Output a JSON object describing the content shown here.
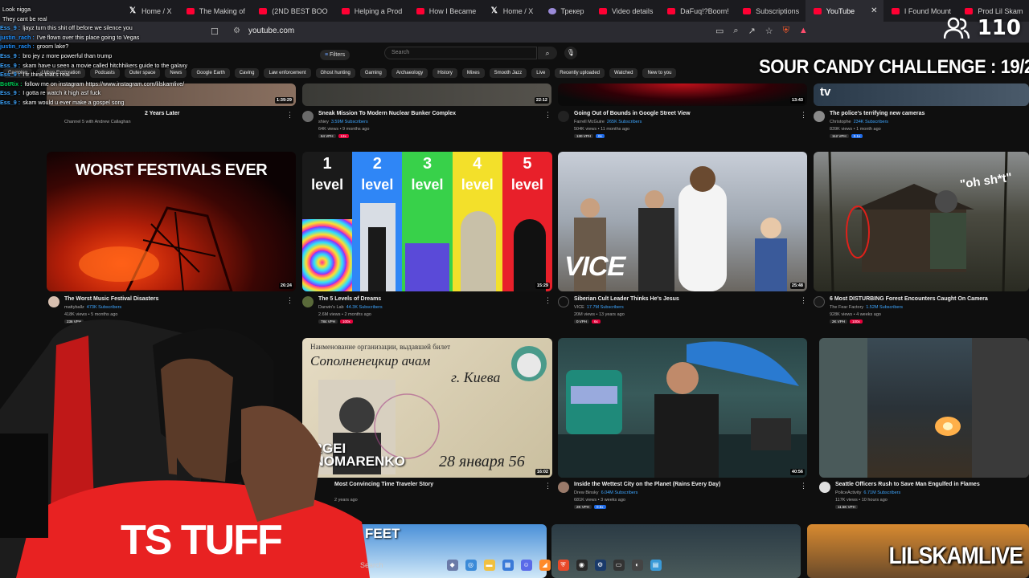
{
  "browser": {
    "tabs": [
      {
        "label": "Home / X",
        "icon": "x-logo-icon"
      },
      {
        "label": "The Making of",
        "icon": "youtube-icon"
      },
      {
        "label": "(2ND BEST BOO",
        "icon": "youtube-icon"
      },
      {
        "label": "Helping a Prod",
        "icon": "youtube-icon"
      },
      {
        "label": "How I Became",
        "icon": "youtube-icon"
      },
      {
        "label": "Home / X",
        "icon": "x-logo-icon"
      },
      {
        "label": "Трекер",
        "icon": "tracker-icon"
      },
      {
        "label": "Video details",
        "icon": "youtube-icon"
      },
      {
        "label": "DaFuq!?Boom!",
        "icon": "youtube-icon"
      },
      {
        "label": "Subscriptions",
        "icon": "youtube-icon"
      },
      {
        "label": "YouTube",
        "icon": "youtube-icon",
        "active": true
      },
      {
        "label": "I Found Mount",
        "icon": "youtube-icon"
      },
      {
        "label": "Prod Lil Skam",
        "icon": "youtube-icon"
      }
    ],
    "close_symbol": "✕",
    "url": "youtube.com"
  },
  "overlay": {
    "viewer_count": "110",
    "challenge": "SOUR CANDY CHALLENGE : 19/250",
    "watermark": "LILSKAMLIVE"
  },
  "chat": [
    {
      "user": "",
      "text": "Look nigga",
      "color": "#9147ff"
    },
    {
      "user": "",
      "text": "They cant be real",
      "color": "#9147ff"
    },
    {
      "user": "Ess_9 :",
      "text": "ljayz turn this shit off before we silence you",
      "color": "#3ea6ff"
    },
    {
      "user": "justin_rach :",
      "text": "I've flown over this place going to Vegas",
      "color": "#1e90ff"
    },
    {
      "user": "justin_rach :",
      "text": "groom lake?",
      "color": "#1e90ff"
    },
    {
      "user": "Ess_9 :",
      "text": "bro jey z more powerful than trump",
      "color": "#3ea6ff"
    },
    {
      "user": "Ess_9 :",
      "text": "skam have u seen a movie called hitchhikers guide to the galaxy",
      "color": "#3ea6ff"
    },
    {
      "user": "Ess_9 :",
      "text": "I fr think that's real",
      "color": "#3ea6ff"
    },
    {
      "user": "BotRix :",
      "text": "follow me on instagram https://www.instagram.com/lilskamlive/",
      "color": "#00c853"
    },
    {
      "user": "Ess_9 :",
      "text": "I gotta re watch it high asf fuck",
      "color": "#3ea6ff"
    },
    {
      "user": "Ess_9 :",
      "text": "skam would u ever make a gospel song",
      "color": "#3ea6ff"
    }
  ],
  "youtube": {
    "filters_label": "Filters",
    "search_placeholder": "Search",
    "chips": [
      "Camping",
      "Urban Exploration",
      "Podcasts",
      "Outer space",
      "News",
      "Google Earth",
      "Caving",
      "Law enforcement",
      "Ghost hunting",
      "Gaming",
      "Archaeology",
      "History",
      "Mixes",
      "Smooth Jazz",
      "Live",
      "Recently uploaded",
      "Watched",
      "New to you"
    ],
    "videos": [
      {
        "title": "2 Years Later",
        "channel": "Channel 5 with Andrew Callaghan",
        "views": "",
        "duration": "1:39:29",
        "subs": ""
      },
      {
        "title": "Sneak Mission To Modern Nuclear Bunker Complex",
        "channel": "shiey",
        "subs": "3.59M Subscribers",
        "views": "64K views • 9 months ago",
        "duration": "22:12",
        "vph": "64 VPH"
      },
      {
        "title": "Going Out of Bounds in Google Street View",
        "channel": "Farrell McGuire",
        "subs": "265K Subscribers",
        "views": "504K views • 11 months ago",
        "duration": "13:43",
        "vph": "130 VPH"
      },
      {
        "title": "The police's terrifying new cameras",
        "channel": "Christophe",
        "subs": "234K Subscribers",
        "views": "839K views • 1 month ago",
        "duration": "",
        "vph": "112 VPH"
      },
      {
        "title": "The Worst Music Festival Disasters",
        "channel": "mattyballz",
        "subs": "473K Subscribers",
        "views": "418K views • 5 months ago",
        "duration": "26:24",
        "vph": "236 VPH",
        "thumb_text": "WORST FESTIVALS EVER"
      },
      {
        "title": "The 5 Levels of Dreams",
        "channel": "Darwin's Lab",
        "subs": "44.3K Subscribers",
        "views": "2.6M views • 2 months ago",
        "duration": "15:29",
        "vph": "784 VPH"
      },
      {
        "title": "Siberian Cult Leader Thinks He's Jesus",
        "channel": "VICE",
        "subs": "17.7M Subscribers",
        "views": "20M views • 13 years ago",
        "duration": "25:48",
        "vph": "0 VPH",
        "thumb_text": "VICE"
      },
      {
        "title": "6 Most DISTURBING Forest Encounters Caught On Camera",
        "channel": "The Fear Factory",
        "subs": "1.52M Subscribers",
        "views": "928K views • 4 weeks ago",
        "duration": "",
        "vph": "2K VPH",
        "thumb_text": "\"oh sh*t\""
      },
      {
        "title": "Most Convincing Time Traveler Story",
        "channel": "",
        "subs": "",
        "views": "2 years ago",
        "duration": "16:02",
        "thumb_text": "SERGEI PONOMARENKO"
      },
      {
        "title": "Inside the Wettest City on the Planet (Rains Every Day)",
        "channel": "Drew Binsky",
        "subs": "6.04M Subscribers",
        "views": "681K views • 3 weeks ago",
        "duration": "40:56",
        "vph": "2K VPH"
      },
      {
        "title": "Seattle Officers Rush to Save Man Engulfed in Flames",
        "channel": "PoliceActivity",
        "subs": "6.71M Subscribers",
        "views": "117K views • 10 hours ago",
        "duration": "",
        "vph": "11.5K VPH"
      }
    ],
    "levels": [
      {
        "num": "1",
        "word": "level",
        "color": "#1a1a1a"
      },
      {
        "num": "2",
        "word": "level",
        "color": "#2f86f6"
      },
      {
        "num": "3",
        "word": "level",
        "color": "#38d14a"
      },
      {
        "num": "4",
        "word": "level",
        "color": "#f3e02a"
      },
      {
        "num": "5",
        "word": "level",
        "color": "#e8202a"
      }
    ],
    "bottom_row_text": "FEET"
  },
  "streamer": {
    "shirt_text": "TS TUFF"
  },
  "taskbar": {
    "search_label": "Search"
  }
}
